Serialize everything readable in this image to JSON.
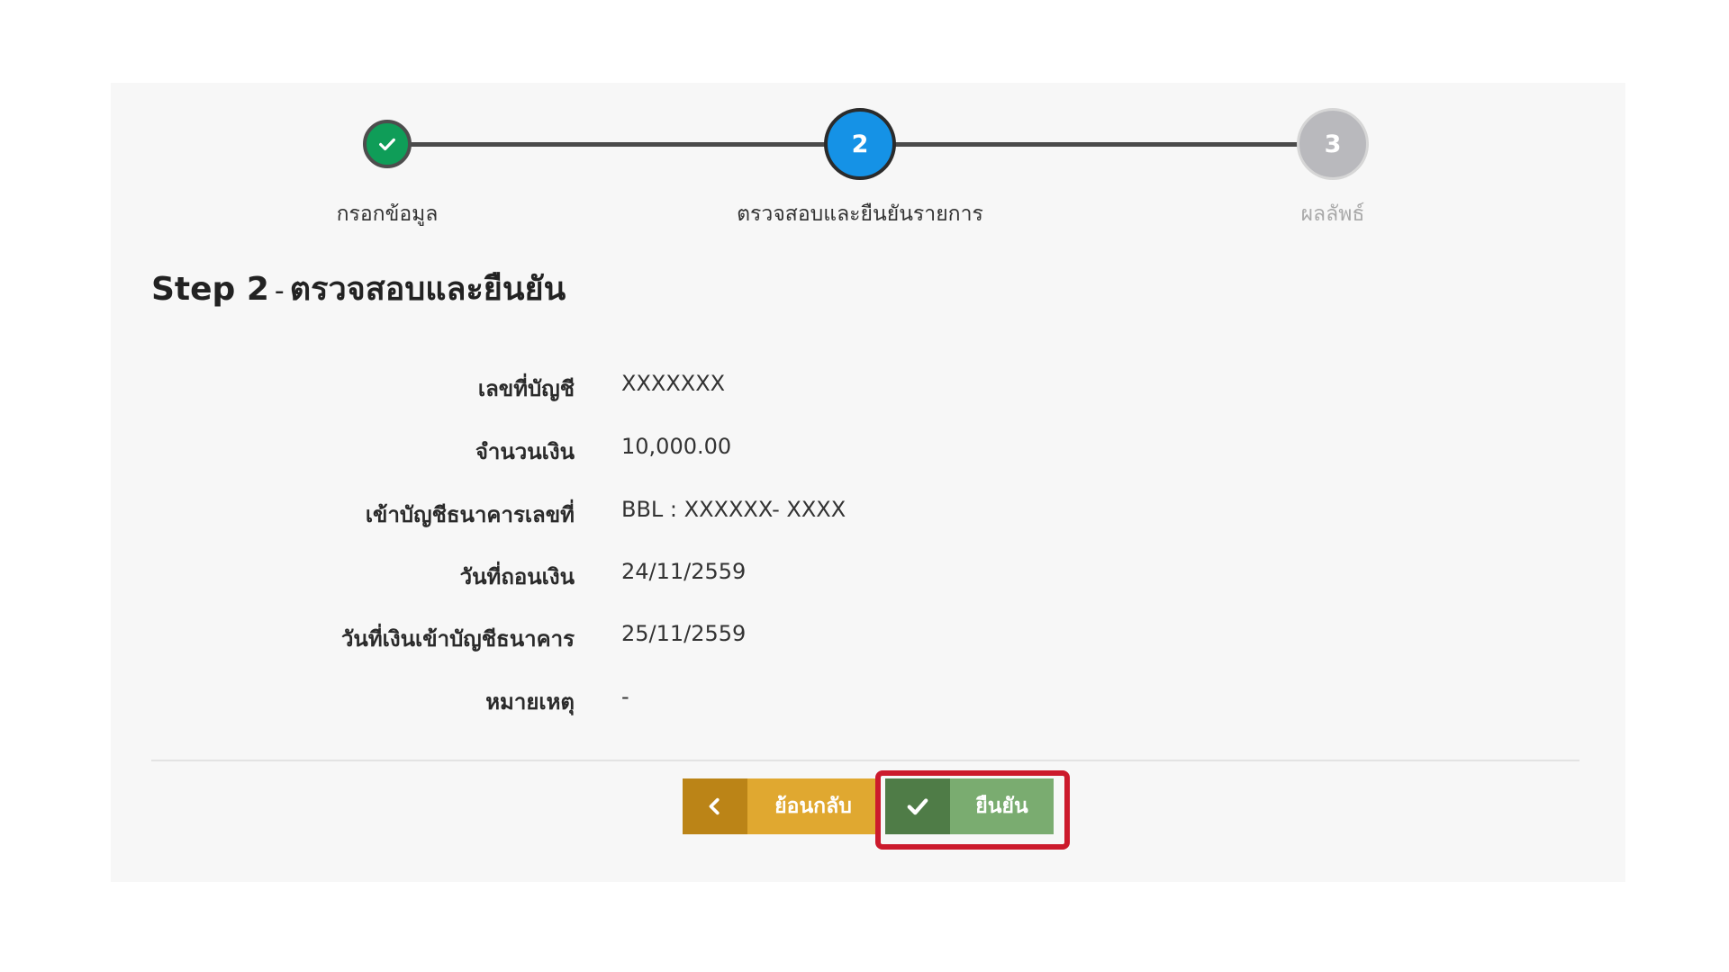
{
  "stepper": {
    "steps": [
      {
        "label": "กรอกข้อมูล",
        "state": "done",
        "icon": "check-icon"
      },
      {
        "label": "ตรวจสอบและยืนยันรายการ",
        "state": "active",
        "number": "2"
      },
      {
        "label": "ผลลัพธ์",
        "state": "pending",
        "number": "3"
      }
    ]
  },
  "title": {
    "step": "Step 2",
    "separator": "-",
    "text": "ตรวจสอบและยืนยัน"
  },
  "details": [
    {
      "label": "เลขที่บัญชี",
      "value": "XXXXXXX"
    },
    {
      "label": "จำนวนเงิน",
      "value": "10,000.00"
    },
    {
      "label": "เข้าบัญชีธนาคารเลขที่",
      "value": "BBL : XXXXXX- XXXX"
    },
    {
      "label": "วันที่ถอนเงิน",
      "value": "24/11/2559"
    },
    {
      "label": "วันที่เงินเข้าบัญชีธนาคาร",
      "value": "25/11/2559"
    },
    {
      "label": "หมายเหตุ",
      "value": "-"
    }
  ],
  "buttons": {
    "back": {
      "label": "ย้อนกลับ",
      "icon": "chevron-left-icon"
    },
    "confirm": {
      "label": "ยืนยัน",
      "icon": "check-icon"
    }
  },
  "colors": {
    "step_done": "#0f9d58",
    "step_active": "#1592e6",
    "step_pending": "#b9b9bd",
    "back_button": "#e0a830",
    "confirm_button": "#7aac70",
    "highlight": "#cc1a2c"
  }
}
